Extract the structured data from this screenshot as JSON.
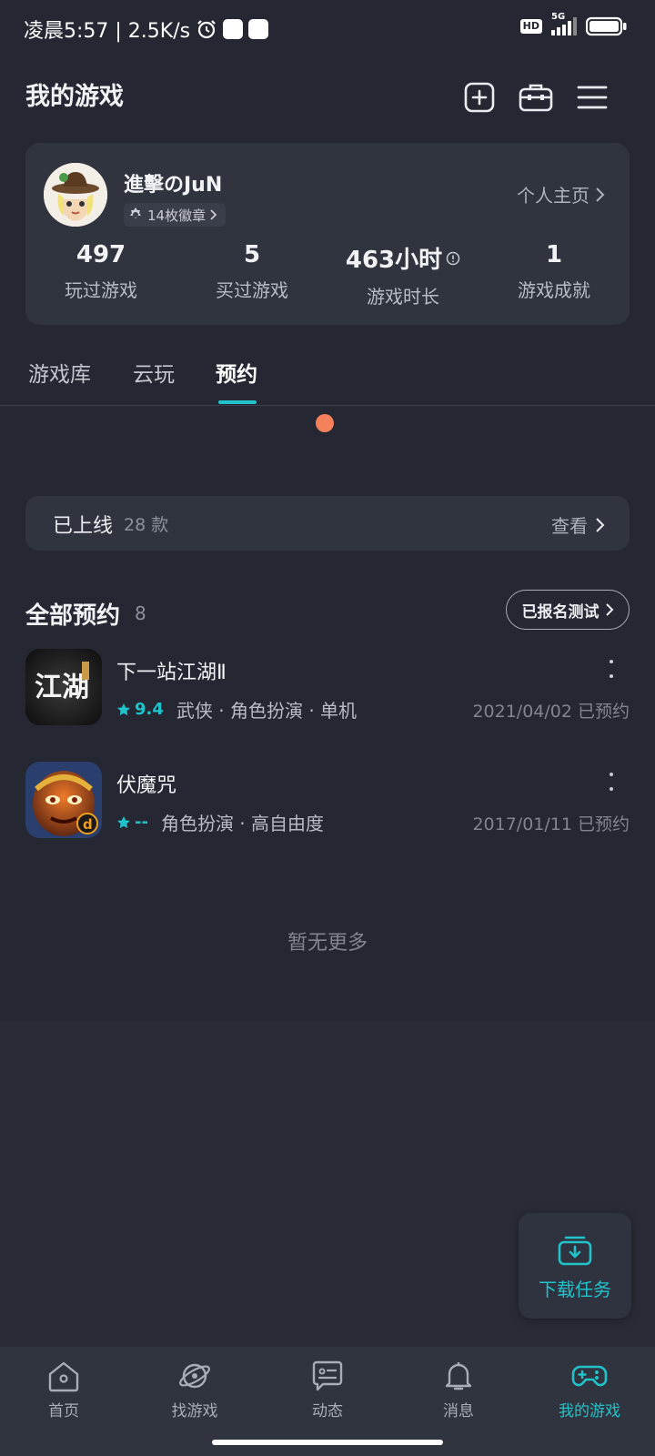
{
  "status_bar": {
    "time_speed": "凌晨5:57 | 2.5K/s",
    "hd_label": "HD",
    "network_label": "5G"
  },
  "header": {
    "title": "我的游戏",
    "icons": [
      "add-square-icon",
      "toolbox-icon",
      "menu-icon"
    ]
  },
  "profile": {
    "username": "進擊のJuN",
    "badges_label": "14枚徽章",
    "homepage_link": "个人主页",
    "stats": [
      {
        "value": "497",
        "label": "玩过游戏"
      },
      {
        "value": "5",
        "label": "买过游戏"
      },
      {
        "value": "463小时",
        "label": "游戏时长"
      },
      {
        "value": "1",
        "label": "游戏成就"
      }
    ]
  },
  "tabs": [
    {
      "label": "游戏库",
      "active": false
    },
    {
      "label": "云玩",
      "active": false
    },
    {
      "label": "预约",
      "active": true
    }
  ],
  "online": {
    "title": "已上线",
    "count": "28 款",
    "view_label": "查看"
  },
  "reservations": {
    "title": "全部预约",
    "count": "8",
    "registered_button": "已报名测试",
    "games": [
      {
        "name": "下一站江湖Ⅱ",
        "rating": "9.4",
        "tags": "武侠 · 角色扮演 · 单机",
        "date": "2021/04/02 已预约",
        "icon_text": "江湖"
      },
      {
        "name": "伏魔咒",
        "rating": "--",
        "tags": "角色扮演 · 高自由度",
        "date": "2017/01/11 已预约",
        "icon_text": ""
      }
    ],
    "no_more": "暂无更多"
  },
  "download_fab": {
    "label": "下载任务"
  },
  "bottom_nav": [
    {
      "label": "首页",
      "icon": "home-icon",
      "active": false
    },
    {
      "label": "找游戏",
      "icon": "planet-icon",
      "active": false
    },
    {
      "label": "动态",
      "icon": "feed-icon",
      "active": false
    },
    {
      "label": "消息",
      "icon": "bell-icon",
      "active": false
    },
    {
      "label": "我的游戏",
      "icon": "gamepad-icon",
      "active": true
    }
  ],
  "colors": {
    "background": "#252833",
    "card": "#30343f",
    "accent": "#21c3ca",
    "notification_dot": "#f5805c"
  }
}
